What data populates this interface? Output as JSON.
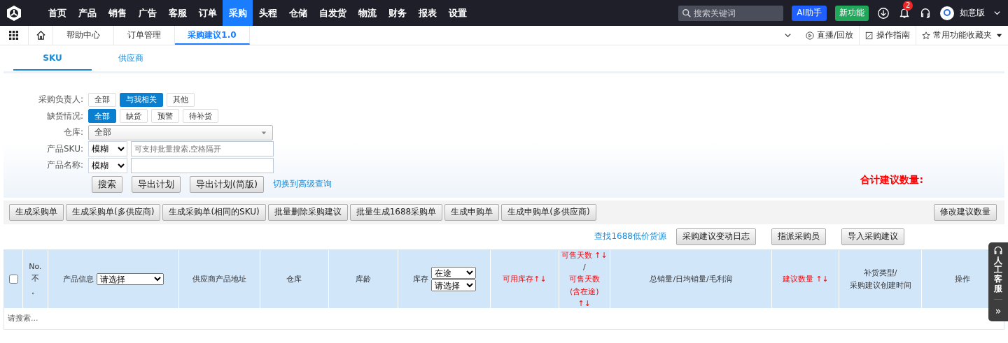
{
  "top_nav": {
    "items": [
      {
        "label": "首页",
        "selected": false
      },
      {
        "label": "产品",
        "selected": false
      },
      {
        "label": "销售",
        "selected": false
      },
      {
        "label": "广告",
        "selected": false
      },
      {
        "label": "客服",
        "selected": false
      },
      {
        "label": "订单",
        "selected": false
      },
      {
        "label": "采购",
        "selected": true
      },
      {
        "label": "头程",
        "selected": false
      },
      {
        "label": "仓储",
        "selected": false
      },
      {
        "label": "自发货",
        "selected": false
      },
      {
        "label": "物流",
        "selected": false
      },
      {
        "label": "财务",
        "selected": false
      },
      {
        "label": "报表",
        "selected": false
      },
      {
        "label": "设置",
        "selected": false
      }
    ],
    "search": {
      "placeholder": "搜索关键词"
    },
    "ai_button": "AI助手",
    "new_button": "新功能",
    "notification_count": "2",
    "user": "如意版"
  },
  "page_tabs": [
    {
      "label": "帮助中心",
      "selected": false
    },
    {
      "label": "订单管理",
      "selected": false
    },
    {
      "label": "采购建议1.0",
      "selected": true
    }
  ],
  "tab_tools": [
    "直播/回放",
    "操作指南",
    "常用功能收藏夹"
  ],
  "sub_tabs": [
    {
      "label": "SKU",
      "selected": true
    },
    {
      "label": "供应商",
      "selected": false
    }
  ],
  "filters": [
    {
      "label": "采购负责人:",
      "kind": "options",
      "options": [
        {
          "label": "全部",
          "selected": false
        },
        {
          "label": "与我相关",
          "selected": true
        },
        {
          "label": "其他",
          "selected": false
        }
      ]
    },
    {
      "label": "缺货情况:",
      "kind": "options",
      "options": [
        {
          "label": "全部",
          "selected": true
        },
        {
          "label": "缺货",
          "selected": false
        },
        {
          "label": "预警",
          "selected": false
        },
        {
          "label": "待补货",
          "selected": false
        }
      ]
    },
    {
      "label": "仓库:",
      "kind": "dropdown",
      "value": "全部"
    },
    {
      "label": "产品SKU:",
      "kind": "search",
      "mode": "模糊",
      "placeholder": "可支持批量搜索,空格隔开"
    },
    {
      "label": "产品名称:",
      "kind": "search",
      "mode": "模糊"
    }
  ],
  "form_buttons": [
    "搜索",
    "导出计划",
    "导出计划(简版)"
  ],
  "advanced_link": "切换到高级查询",
  "total_label": "合计建议数量:",
  "toolbar_buttons": [
    "生成采购单",
    "生成采购单(多供应商)",
    "生成采购单(相同的SKU)",
    "批量删除采购建议",
    "批量生成1688采购单",
    "生成申购单",
    "生成申购单(多供应商)"
  ],
  "toolbar_right_button": "修改建议数量",
  "link_row": {
    "link": "查找1688低价货源",
    "buttons": [
      "采购建议变动日志",
      "指派采购员",
      "导入采购建议"
    ]
  },
  "table": {
    "columns": [
      {
        "kind": "checkbox",
        "checked": false
      },
      {
        "kind": "text",
        "parts": [
          {
            "text": "No.",
            "sortable": false
          },
          {
            "text": "不",
            "sortable": false
          },
          {
            "text": "。",
            "sortable": false
          }
        ]
      },
      {
        "kind": "select",
        "parts": [
          {
            "text": "产品信息",
            "sortable": false
          }
        ],
        "selects": [
          "请选择"
        ]
      },
      {
        "kind": "text",
        "parts": [
          {
            "text": "供应商产品地址",
            "sortable": false
          }
        ]
      },
      {
        "kind": "text",
        "parts": [
          {
            "text": "仓库",
            "sortable": false
          }
        ]
      },
      {
        "kind": "text",
        "parts": [
          {
            "text": "库龄",
            "sortable": false
          }
        ]
      },
      {
        "kind": "select",
        "parts": [
          {
            "text": "库存",
            "sortable": false
          }
        ],
        "selects": [
          "在途",
          "请选择"
        ]
      },
      {
        "kind": "text",
        "parts": [
          {
            "text": "可用库存↑↓",
            "sortable": true
          }
        ]
      },
      {
        "kind": "text",
        "parts": [
          {
            "text": "可售天数 ↑↓",
            "sortable": true
          },
          {
            "text": "/",
            "sortable": false
          },
          {
            "text": "可售天数",
            "sortable": true
          },
          {
            "text": "(含在途)",
            "sortable": true
          },
          {
            "text": "↑↓",
            "sortable": true
          }
        ]
      },
      {
        "kind": "text",
        "parts": [
          {
            "text": "总销量/日均销量/毛利润",
            "sortable": false
          }
        ]
      },
      {
        "kind": "text",
        "parts": [
          {
            "text": "建议数量 ↑↓",
            "sortable": true
          }
        ]
      },
      {
        "kind": "text",
        "parts": [
          {
            "text": "补货类型/",
            "sortable": false
          },
          {
            "text": "采购建议创建时间",
            "sortable": false
          }
        ]
      },
      {
        "kind": "text",
        "parts": [
          {
            "text": "操作",
            "sortable": false
          }
        ]
      }
    ],
    "empty_text": "请搜索..."
  },
  "float_service": {
    "label": "人工客服",
    "collapse": "»"
  }
}
